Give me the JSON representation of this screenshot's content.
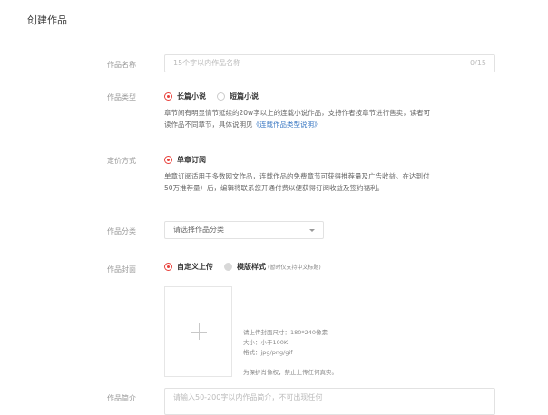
{
  "header": {
    "title": "创建作品"
  },
  "form": {
    "name": {
      "label": "作品名称",
      "placeholder": "15个字以内作品名称",
      "counter": "0/15"
    },
    "type": {
      "label": "作品类型",
      "options": [
        "长篇小说",
        "短篇小说"
      ],
      "selected": "长篇小说",
      "description_line1": "章节间有明显情节延续的20w字以上的连载小说作品，支持作者按章节进行售卖，读者可",
      "description_line2_prefix": "读作品不同章节，具体说明见",
      "description_link": "《连载作品类型说明》"
    },
    "pricing": {
      "label": "定价方式",
      "option": "单章订阅",
      "description_line1": "单章订阅适用于多数网文作品，连载作品的免费章节可获得推荐量及广告收益。在达到付",
      "description_line2": "50万推荐量）后，编辑将联系您开通付费以便获得订阅收益及签约福利。"
    },
    "category": {
      "label": "作品分类",
      "placeholder": "请选择作品分类"
    },
    "cover": {
      "label": "作品封面",
      "options": [
        "自定义上传",
        "模版样式"
      ],
      "template_note": "(暂时仅支持中文标题)",
      "hints": [
        "请上传封面尺寸：180*240像素",
        "大小：小于100K",
        "格式：jpg/png/gif",
        "为保护肖像权，禁止上传任何真实。"
      ]
    },
    "intro": {
      "label": "作品简介",
      "placeholder": "请输入50-200字以内作品简介，不可出现任何"
    }
  },
  "colors": {
    "accent": "#e8403a",
    "link": "#3a78c3"
  }
}
